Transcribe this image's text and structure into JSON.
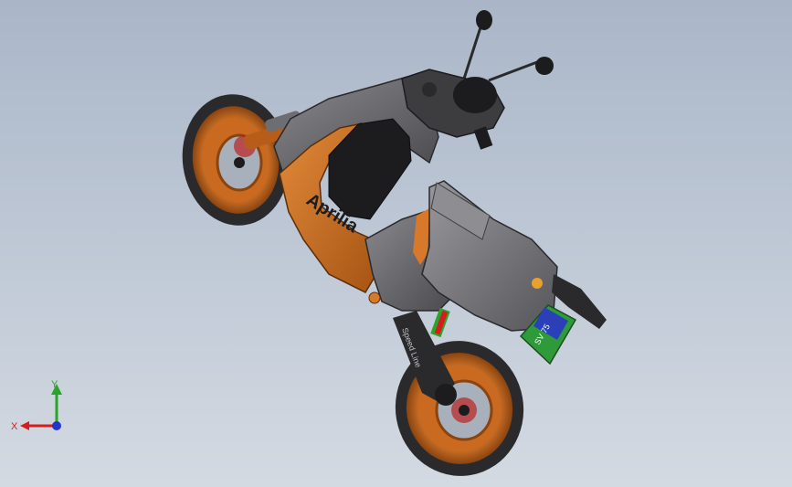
{
  "model": {
    "brand_text": "Aprilia",
    "plate_text": "SV 75",
    "colors": {
      "orange": "#d8782a",
      "orange_dark": "#9a4c12",
      "gray": "#6e6e72",
      "gray_dark": "#3d3d40",
      "black": "#1c1c1e",
      "tire": "#2a2a2c",
      "green_plate": "#2f9a3a",
      "blue_plate": "#2a3fb8"
    }
  },
  "triad": {
    "x_label": "X",
    "y_label": "Y",
    "x_color": "#d41e1e",
    "y_color": "#2aa52a",
    "z_color": "#2236c8"
  }
}
